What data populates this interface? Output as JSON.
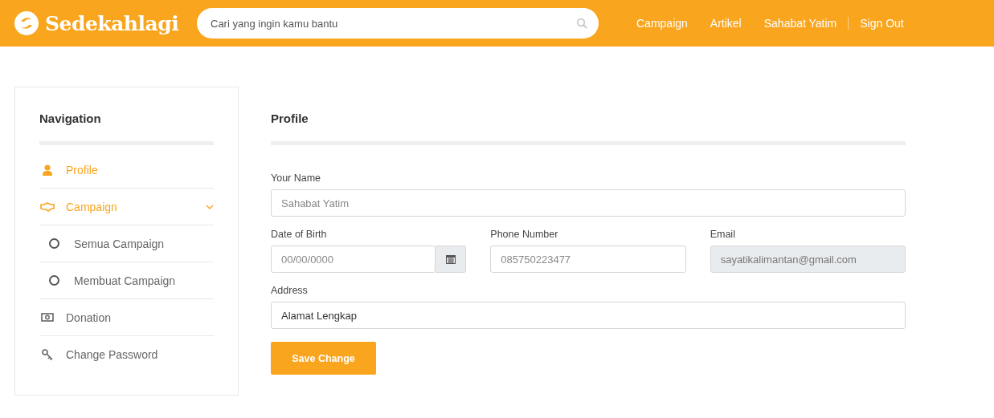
{
  "header": {
    "brand": "Sedekahlagi",
    "search": {
      "placeholder": "Cari yang ingin kamu bantu"
    },
    "links": [
      {
        "label": "Campaign"
      },
      {
        "label": "Artikel"
      },
      {
        "label": "Sahabat Yatim"
      },
      {
        "label": "Sign Out"
      }
    ]
  },
  "sidebar": {
    "title": "Navigation",
    "items": [
      {
        "label": "Profile",
        "selected": true
      },
      {
        "label": "Campaign",
        "selected": true,
        "expanded": true,
        "children": [
          {
            "label": "Semua Campaign",
            "selected": false
          },
          {
            "label": "Membuat Campaign",
            "selected": false
          }
        ]
      },
      {
        "label": "Donation",
        "selected": false
      },
      {
        "label": "Change Password",
        "selected": false
      }
    ]
  },
  "form": {
    "title": "Profile",
    "fields": [
      {
        "label": "Your Name",
        "placeholder": "Sahabat Yatim",
        "disabled": false
      },
      {
        "label": "Date of Birth",
        "placeholder": "00/00/0000",
        "disabled": false,
        "kind": "date"
      },
      {
        "label": "Phone Number",
        "placeholder": "085750223477",
        "disabled": false
      },
      {
        "label": "Email",
        "value": "sayatikalimantan@gmail.com",
        "disabled": true
      },
      {
        "label": "Address",
        "value": "Alamat Lengkap",
        "disabled": false
      }
    ],
    "button": "Save Change"
  }
}
